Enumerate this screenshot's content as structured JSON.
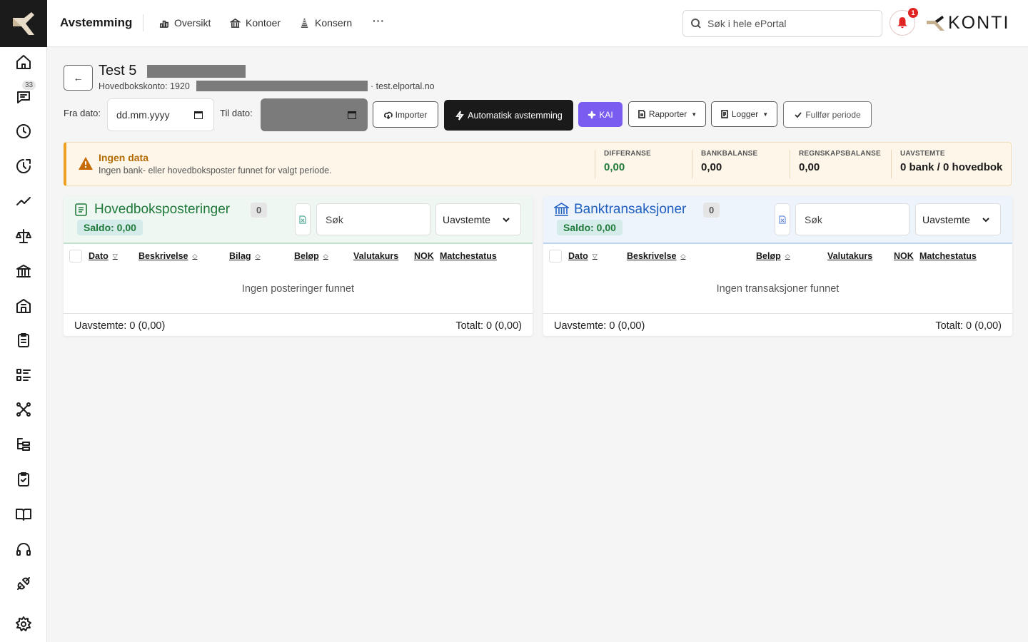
{
  "header": {
    "app_title": "Avstemming",
    "nav": [
      "Oversikt",
      "Kontoer",
      "Konsern"
    ],
    "more": "···",
    "search_placeholder": "Søk i hele ePortal",
    "notif_count": "1",
    "brand": "KONTI"
  },
  "sidebar": {
    "items": [
      "home-icon",
      "chat-icon",
      "clock-icon",
      "history-icon",
      "trend-icon",
      "scale-icon",
      "bank-icon",
      "building-icon",
      "clipboard-icon",
      "list-icon",
      "network-icon",
      "tree-icon",
      "checklist-icon",
      "book-icon",
      "headset-icon",
      "plug-icon",
      "gear-icon"
    ],
    "chat_badge": "33"
  },
  "page": {
    "title": "Test 5",
    "account": "Hovedbokskonto: 1920",
    "domain": "· test.elportal.no",
    "fra_label": "Fra dato:",
    "fra_placeholder": "dd.mm.yyyy",
    "til_label": "Til dato:"
  },
  "toolbar": {
    "importer": "Importer",
    "auto": "Automatisk avstemming",
    "kai": "KAI",
    "rapporter": "Rapporter",
    "logger": "Logger",
    "fullfor": "Fullfør periode"
  },
  "alert": {
    "title": "Ingen data",
    "message": "Ingen bank- eller hovedboksposter funnet for valgt periode.",
    "stats": [
      {
        "label": "DIFFERANSE",
        "value": "0,00",
        "color": "#1f7a3a"
      },
      {
        "label": "BANKBALANSE",
        "value": "0,00",
        "color": "#1a1a1a"
      },
      {
        "label": "REGNSKAPSBALANSE",
        "value": "0,00",
        "color": "#1a1a1a"
      },
      {
        "label": "UAVSTEMTE",
        "value": "0 bank / 0 hovedbok",
        "color": "#1a1a1a"
      }
    ]
  },
  "ledger": {
    "title": "Hovedboksposteringer",
    "count": "0",
    "saldo": "Saldo: 0,00",
    "search": "Søk",
    "filter": "Uavstemte",
    "columns": [
      "Dato",
      "Beskrivelse",
      "Bilag",
      "Beløp",
      "Valutakurs",
      "NOK",
      "Matchestatus"
    ],
    "empty": "Ingen posteringer funnet",
    "footer_left": "Uavstemte: 0 (0,00)",
    "footer_right": "Totalt: 0 (0,00)",
    "accent": "#1f7a3a"
  },
  "bank": {
    "title": "Banktransaksjoner",
    "count": "0",
    "saldo": "Saldo: 0,00",
    "search": "Søk",
    "filter": "Uavstemte",
    "columns": [
      "Dato",
      "Beskrivelse",
      "Beløp",
      "Valutakurs",
      "NOK",
      "Matchestatus"
    ],
    "empty": "Ingen transaksjoner funnet",
    "footer_left": "Uavstemte: 0 (0,00)",
    "footer_right": "Totalt: 0 (0,00)",
    "accent": "#1f5fbf"
  }
}
